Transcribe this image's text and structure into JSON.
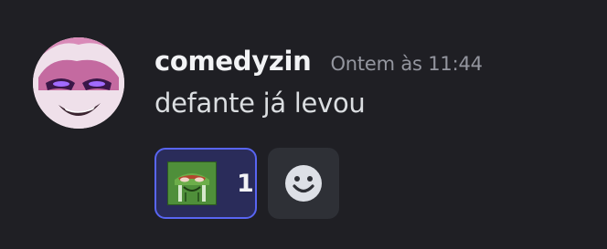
{
  "message": {
    "username": "comedyzin",
    "timestamp": "Ontem às 11:44",
    "content": "defante já levou"
  },
  "reactions": [
    {
      "emoji_icon": "pepe-frog-icon",
      "count": "1",
      "selected": true
    }
  ],
  "add_reaction": {
    "icon": "smiley-face-icon"
  },
  "colors": {
    "background": "#1f1f24",
    "username": "#f2f3f5",
    "timestamp": "#94969f",
    "content": "#dbdee1",
    "reaction_bg": "#2a2c5a",
    "reaction_border": "#5865f2",
    "add_reaction_bg": "#2e3036"
  }
}
